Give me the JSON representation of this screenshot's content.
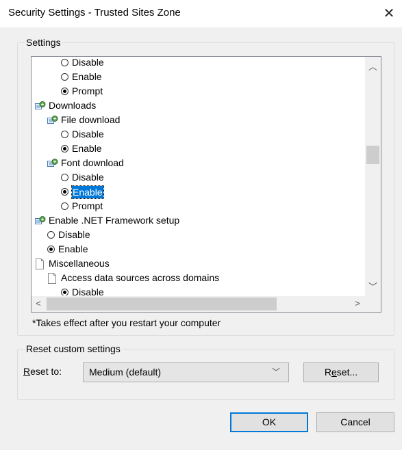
{
  "window": {
    "title": "Security Settings - Trusted Sites Zone"
  },
  "settings_group": {
    "label": "Settings"
  },
  "tree": [
    {
      "text": "Disable",
      "kind": "radio",
      "checked": false,
      "indent": 2
    },
    {
      "text": "Enable",
      "kind": "radio",
      "checked": false,
      "indent": 2
    },
    {
      "text": "Prompt",
      "kind": "radio",
      "checked": true,
      "indent": 2
    },
    {
      "text": "Downloads",
      "kind": "category",
      "indent": 0
    },
    {
      "text": "File download",
      "kind": "category",
      "indent": 1
    },
    {
      "text": "Disable",
      "kind": "radio",
      "checked": false,
      "indent": 2
    },
    {
      "text": "Enable",
      "kind": "radio",
      "checked": true,
      "indent": 2
    },
    {
      "text": "Font download",
      "kind": "category",
      "indent": 1
    },
    {
      "text": "Disable",
      "kind": "radio",
      "checked": false,
      "indent": 2
    },
    {
      "text": "Enable",
      "kind": "radio",
      "checked": true,
      "indent": 2,
      "selected": true
    },
    {
      "text": "Prompt",
      "kind": "radio",
      "checked": false,
      "indent": 2
    },
    {
      "text": "Enable .NET Framework setup",
      "kind": "category",
      "indent": 0
    },
    {
      "text": "Disable",
      "kind": "radio",
      "checked": false,
      "indent": 1
    },
    {
      "text": "Enable",
      "kind": "radio",
      "checked": true,
      "indent": 1
    },
    {
      "text": "Miscellaneous",
      "kind": "document",
      "indent": 0
    },
    {
      "text": "Access data sources across domains",
      "kind": "document",
      "indent": 1
    },
    {
      "text": "Disable",
      "kind": "radio",
      "checked": true,
      "indent": 2
    }
  ],
  "note": "*Takes effect after you restart your computer",
  "reset_group": {
    "label": "Reset custom settings",
    "reset_to_label_pre": "",
    "reset_to_label_u": "R",
    "reset_to_label_post": "eset to:",
    "selected_level": "Medium (default)",
    "reset_button_pre": "R",
    "reset_button_u": "e",
    "reset_button_post": "set..."
  },
  "buttons": {
    "ok": "OK",
    "cancel": "Cancel"
  }
}
